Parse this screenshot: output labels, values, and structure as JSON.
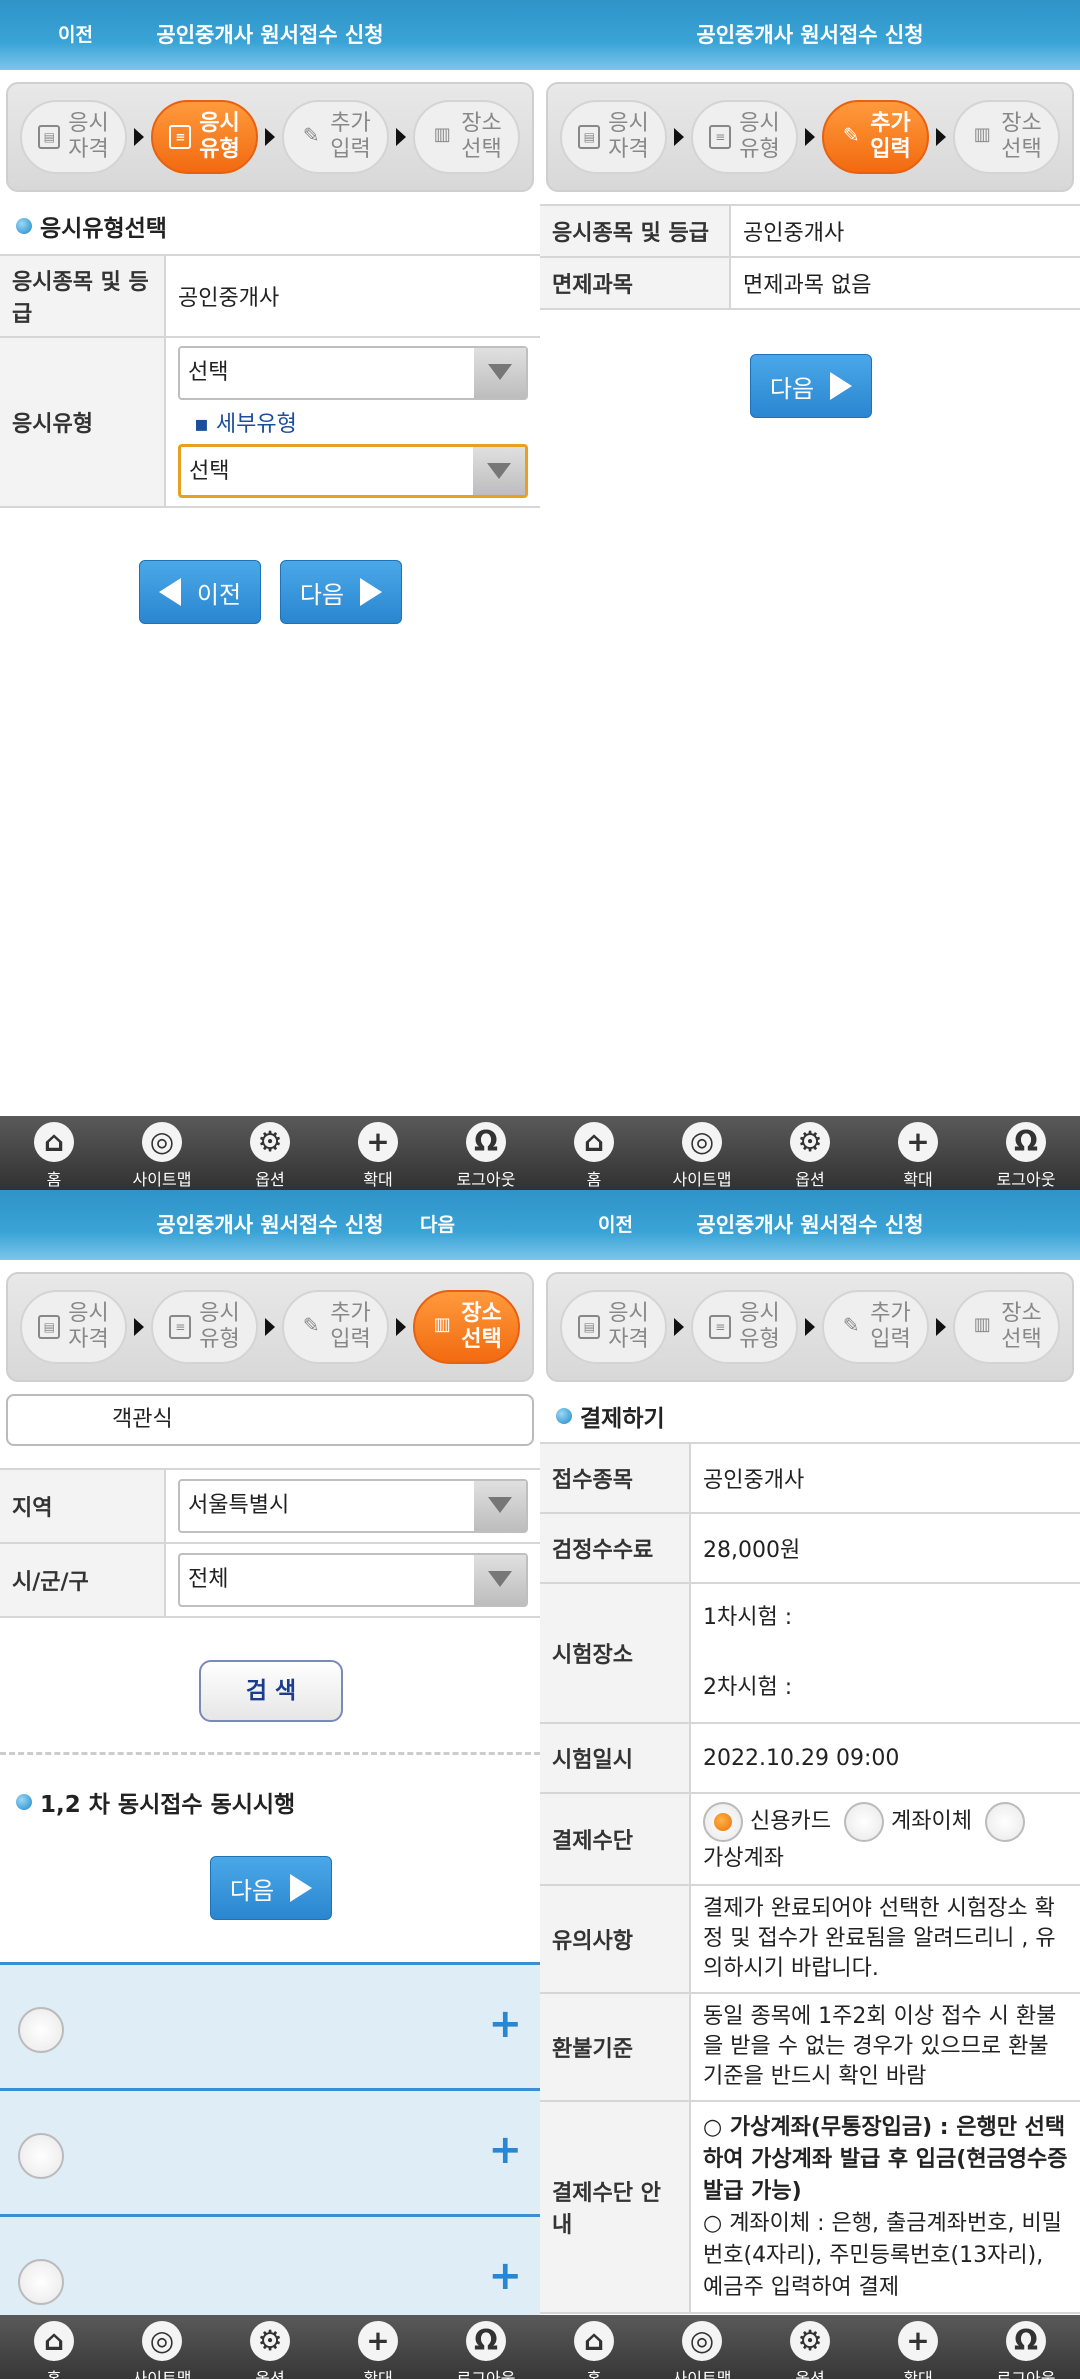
{
  "q1": {
    "header": {
      "prev": "이전",
      "title": "공인중개사 원서접수 신청"
    },
    "steps": [
      {
        "icon": "applicant-icon",
        "l1": "응시",
        "l2": "자격"
      },
      {
        "icon": "document-icon",
        "l1": "응시",
        "l2": "유형"
      },
      {
        "icon": "pencil-icon",
        "l1": "추가",
        "l2": "입력"
      },
      {
        "icon": "building-icon",
        "l1": "장소",
        "l2": "선택"
      }
    ],
    "section_title": "응시유형선택",
    "row1_label": "응시종목 및 등급",
    "row1_value": "공인중개사",
    "row2_label": "응시유형",
    "type_select": "선택",
    "subtype_label": "세부유형",
    "subtype_select": "선택",
    "prev_button": "이전",
    "next_button": "다음"
  },
  "q2": {
    "header": {
      "title": "공인중개사 원서접수 신청"
    },
    "row1_label": "응시종목 및 등급",
    "row1_value": "공인중개사",
    "row2_label": "면제과목",
    "row2_value": "면제과목 없음",
    "next_button": "다음"
  },
  "nav": {
    "home": "홈",
    "sitemap": "사이트맵",
    "options": "옵션",
    "zoom": "확대",
    "logout": "로그아웃"
  },
  "q3": {
    "header": {
      "title": "공인중개사 원서접수 신청",
      "next": "다음"
    },
    "exam_type": "객관식",
    "region_label": "지역",
    "region_value": "서울특별시",
    "district_label": "시/군/구",
    "district_value": "전체",
    "search_button": "검 색",
    "section_title": "1,2 차 동시접수 동시시행",
    "next_button": "다음"
  },
  "q4": {
    "header": {
      "prev": "이전",
      "title": "공인중개사 원서접수 신청"
    },
    "section_title": "결제하기",
    "rows": {
      "item_label": "접수종목",
      "item_value": "공인중개사",
      "fee_label": "검정수수료",
      "fee_value": "28,000원",
      "place_label": "시험장소",
      "place_1": "1차시험 :",
      "place_2": "2차시험 :",
      "date_label": "시험일시",
      "date_value": "2022.10.29 09:00",
      "method_label": "결제수단",
      "m_card": "신용카드",
      "m_transfer": "계좌이체",
      "m_virtual": "가상계좌",
      "notice_label": "유의사항",
      "notice_value": "결제가 완료되어야 선택한 시험장소 확정 및 접수가 완료됨을 알려드리니 , 유의하시기 바랍니다.",
      "refund_label": "환불기준",
      "refund_value": "동일 종목에 1주2회 이상 접수 시 환불을 받을 수 없는 경우가 있으므로 환불기준을 반드시 확인 바람",
      "guide_label": "결제수단 안내",
      "guide_1": "○ 가상계좌(무통장입금) : 은행만 선택하여 가상계좌 발급 후 입금(현금영수증 발급 가능)",
      "guide_2": "○ 계좌이체 : 은행, 출금계좌번호, 비밀번호(4자리), 주민등록번호(13자리), 예금주 입력하여 결제"
    }
  }
}
